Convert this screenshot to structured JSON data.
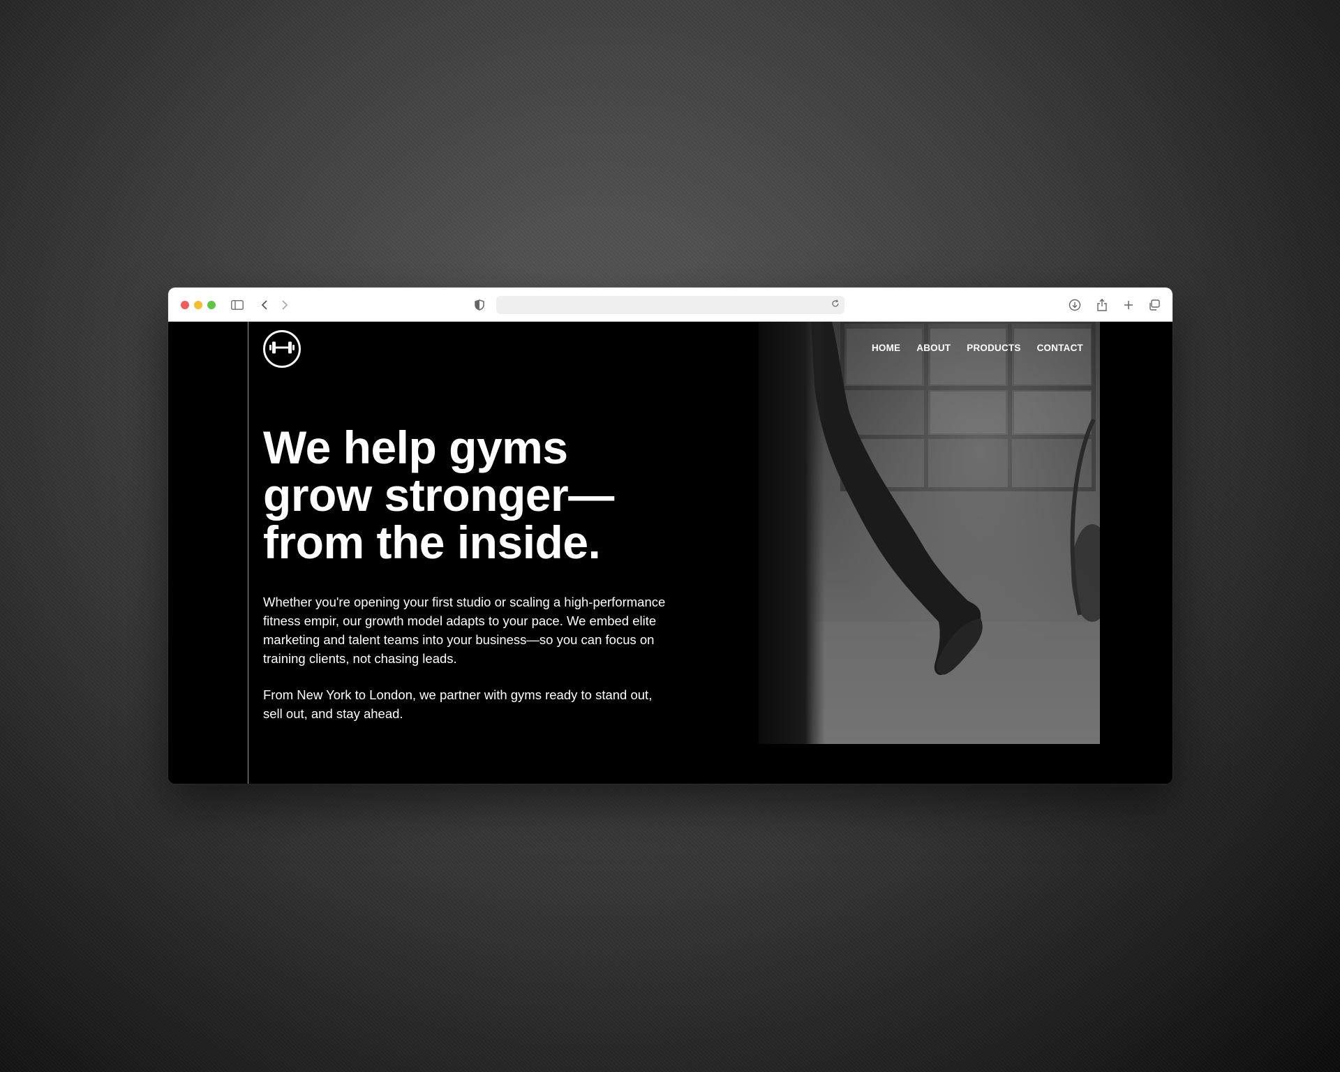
{
  "browser": {
    "url": "",
    "icons": [
      "sidebar-icon",
      "back-icon",
      "forward-icon",
      "shield-icon",
      "reload-icon",
      "download-icon",
      "share-icon",
      "new-tab-icon",
      "tabs-overview-icon"
    ]
  },
  "site": {
    "logo_icon": "dumbbell-icon",
    "nav": [
      {
        "label": "HOME"
      },
      {
        "label": "ABOUT"
      },
      {
        "label": "PRODUCTS"
      },
      {
        "label": "CONTACT"
      }
    ],
    "headline_lines": [
      "We help gyms",
      "grow stronger—",
      "from the inside."
    ],
    "paragraphs": [
      "Whether you're opening your first studio or scaling a high-performance fitness empir, our growth model adapts to your pace. We embed elite marketing and talent teams into your business—so you can focus on training clients, not chasing leads.",
      "From New York to London, we partner with gyms ready to stand out, sell out, and stay ahead."
    ]
  },
  "colors": {
    "page_background": "#000000",
    "text": "#ffffff",
    "accent_line": "#9a9a9a"
  }
}
